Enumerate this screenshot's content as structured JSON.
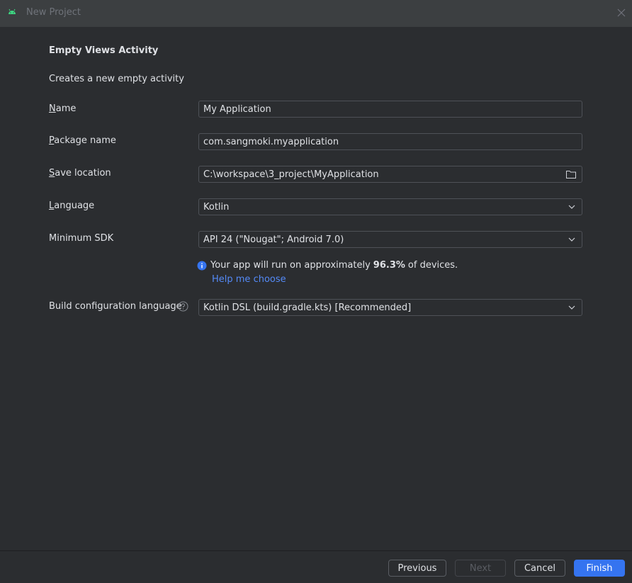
{
  "window": {
    "title": "New Project",
    "app_icon": "android-icon",
    "close_icon": "close-icon"
  },
  "template": {
    "heading": "Empty Views Activity",
    "description": "Creates a new empty activity"
  },
  "form": {
    "name": {
      "label_hotkey": "N",
      "label_rest": "ame",
      "value": "My Application"
    },
    "package_name": {
      "label_hotkey": "P",
      "label_rest": "ackage name",
      "value": "com.sangmoki.myapplication"
    },
    "save_location": {
      "label_hotkey": "S",
      "label_rest": "ave location",
      "value": "C:\\workspace\\3_project\\MyApplication",
      "icon": "folder-icon"
    },
    "language": {
      "label_hotkey": "L",
      "label_rest": "anguage",
      "value": "Kotlin"
    },
    "minimum_sdk": {
      "label": "Minimum SDK",
      "value": "API 24 (\"Nougat\"; Android 7.0)"
    },
    "sdk_info": {
      "prefix": "Your app will run on approximately ",
      "percent": "96.3%",
      "suffix": " of devices.",
      "help_link": "Help me choose",
      "icon": "info-icon"
    },
    "build_config": {
      "label": "Build configuration language",
      "value": "Kotlin DSL (build.gradle.kts) [Recommended]",
      "help_icon": "question-icon"
    }
  },
  "footer": {
    "previous": "Previous",
    "next": "Next",
    "cancel": "Cancel",
    "finish": "Finish"
  },
  "colors": {
    "background": "#2b2d30",
    "titlebar": "#3c3f41",
    "accent": "#3574f0",
    "link": "#548af7",
    "text": "#dfe1e5",
    "field_border": "#4e5157"
  }
}
